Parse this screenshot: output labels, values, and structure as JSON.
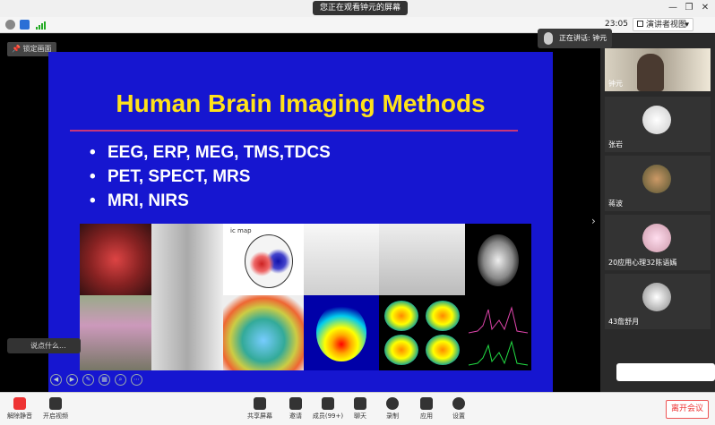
{
  "window": {
    "banner": "您正在观看钟元的屏幕",
    "clock": "23:05",
    "view_mode": "演讲者视图"
  },
  "stage": {
    "lock_label": "锁定画面",
    "chat_placeholder": "说点什么...",
    "speaking_label": "正在讲话: 钟元"
  },
  "slide": {
    "title": "Human Brain Imaging Methods",
    "bullets": [
      "EEG, ERP, MEG, TMS,TDCS",
      "PET, SPECT, MRS",
      "MRI, NIRS"
    ],
    "image_caption": "ic map"
  },
  "participants": [
    {
      "name": "钟元"
    },
    {
      "name": "张岩"
    },
    {
      "name": "蒋波"
    },
    {
      "name": "20应用心理32陈语嫣"
    },
    {
      "name": "43詹舒月"
    }
  ],
  "toolbar": {
    "mute": "解除静音",
    "video": "开启视频",
    "share": "共享屏幕",
    "invite": "邀请",
    "members": "成员(99+)",
    "chat": "聊天",
    "record": "录制",
    "apps": "应用",
    "settings": "设置",
    "leave": "离开会议"
  },
  "colors": {
    "slide_bg": "#1616d0",
    "title": "#ffe21a",
    "rule": "#c8367a",
    "leave": "#e33333"
  }
}
